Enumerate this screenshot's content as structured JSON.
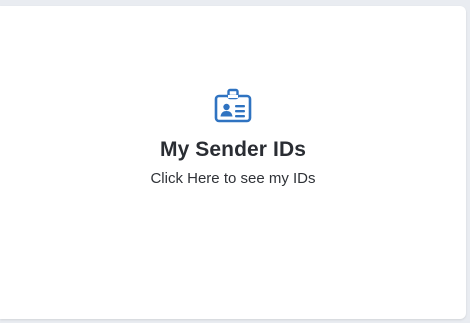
{
  "card": {
    "title": "My Sender IDs",
    "subtitle": "Click Here to see my IDs",
    "icon": "id-badge-icon",
    "accent_color": "#2f73c1"
  }
}
